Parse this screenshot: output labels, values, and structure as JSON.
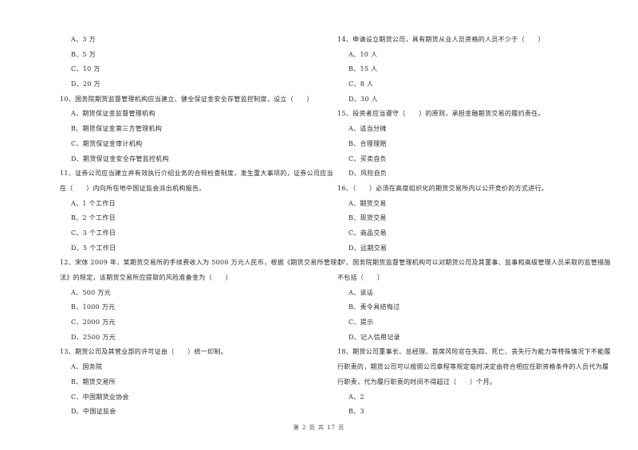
{
  "left_column": [
    {
      "type": "opt",
      "text": "A、3 万"
    },
    {
      "type": "opt",
      "text": "B、5 万"
    },
    {
      "type": "opt",
      "text": "C、10 万"
    },
    {
      "type": "opt",
      "text": "D、20 万"
    },
    {
      "type": "q",
      "text": "10、国务院期货监督管理机构应当建立、健全保证金安全存管监控制度，设立（　　）"
    },
    {
      "type": "opt",
      "text": "A、期货保证金监督管理机构"
    },
    {
      "type": "opt",
      "text": "B、期货保证金第三方管理机构"
    },
    {
      "type": "opt",
      "text": "C、期货保证金审计机构"
    },
    {
      "type": "opt",
      "text": "D、期货保证金安全存管监控机构"
    },
    {
      "type": "q",
      "text": "11、证券公司应当建立并有效执行介绍业务的合规检查制度，发生重大事项的，证券公司应当"
    },
    {
      "type": "q",
      "text": "在（　　）内向所在地中国证监会派出机构报告。"
    },
    {
      "type": "opt",
      "text": "A、1 个工作日"
    },
    {
      "type": "opt",
      "text": "B、2 个工作日"
    },
    {
      "type": "opt",
      "text": "C、3 个工作日"
    },
    {
      "type": "opt",
      "text": "D、5 个工作日"
    },
    {
      "type": "q",
      "text": "12、宋体 2009 年，某期货交易所的手续费收入为 5000 万元人民币，根据《期货交易所管理办"
    },
    {
      "type": "q",
      "text": "法》的规定，该期货交易所应提取的风险准备金为（　　）"
    },
    {
      "type": "opt",
      "text": "A、500 万元"
    },
    {
      "type": "opt",
      "text": "B、1000 万元"
    },
    {
      "type": "opt",
      "text": "C、2000 万元"
    },
    {
      "type": "opt",
      "text": "D、2500 万元"
    },
    {
      "type": "q",
      "text": "13、期货公司及其营业部的许可证由（　　）统一印制。"
    },
    {
      "type": "opt",
      "text": "A、国务院"
    },
    {
      "type": "opt",
      "text": "B、期货交易所"
    },
    {
      "type": "opt",
      "text": "C、中国期货业协会"
    },
    {
      "type": "opt",
      "text": "D、中国证监会"
    }
  ],
  "right_column": [
    {
      "type": "q",
      "text": "14、申请设立期货公司，具有期货从业人员资格的人员不少于（　　）"
    },
    {
      "type": "opt",
      "text": "A、10 人"
    },
    {
      "type": "opt",
      "text": "B、15 人"
    },
    {
      "type": "opt",
      "text": "C、8 人"
    },
    {
      "type": "opt",
      "text": "D、30 人"
    },
    {
      "type": "q",
      "text": "15、投资者应当遵守（　　）的原则，承担金融期货交易的履约责任。"
    },
    {
      "type": "opt",
      "text": "A、适当分摊"
    },
    {
      "type": "opt",
      "text": "B、合理理赔"
    },
    {
      "type": "opt",
      "text": "C、买卖自负"
    },
    {
      "type": "opt",
      "text": "D、风险自负"
    },
    {
      "type": "q",
      "text": "16、（　　）必须在高度组织化的期货交易所内以公开竞价的方式进行。"
    },
    {
      "type": "opt",
      "text": "A、期货交易"
    },
    {
      "type": "opt",
      "text": "B、现货交易"
    },
    {
      "type": "opt",
      "text": "C、商品交易"
    },
    {
      "type": "opt",
      "text": "D、远期交易"
    },
    {
      "type": "q",
      "text": "17、国务院期货监督管理机构可以对期货公司及其董事、监事和高级管理人员采取的监管措施"
    },
    {
      "type": "q",
      "text": "不包括（　　）"
    },
    {
      "type": "opt",
      "text": "A、谈话"
    },
    {
      "type": "opt",
      "text": "B、责令具结悔过"
    },
    {
      "type": "opt",
      "text": "C、提示"
    },
    {
      "type": "opt",
      "text": "D、记入信用记录"
    },
    {
      "type": "q",
      "text": "18、期货公司董事长、总经理、首席风险官在失踪、死亡、丧失行为能力等特殊情况下不能履"
    },
    {
      "type": "q",
      "text": "行职责的，期货公司可以按照公司章程等规定临时决定由符合相应任职资格条件的人员代为履"
    },
    {
      "type": "q",
      "text": "行职责，代为履行职责的时间不得超过（　　）个月。"
    },
    {
      "type": "opt",
      "text": "A、2"
    },
    {
      "type": "opt",
      "text": "B、3"
    }
  ],
  "footer": {
    "page_label": "第 2 页 共 17 页"
  }
}
